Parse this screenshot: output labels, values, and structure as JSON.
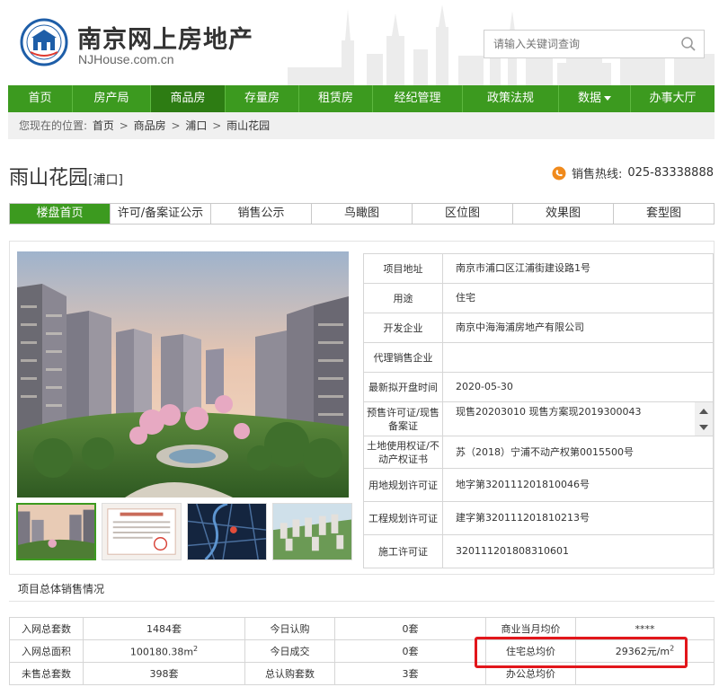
{
  "header": {
    "site_title": "南京网上房地产",
    "site_domain": "NJHouse.com.cn",
    "search_placeholder": "请输入关键词查询"
  },
  "nav": {
    "items": [
      {
        "label": "首页"
      },
      {
        "label": "房产局"
      },
      {
        "label": "商品房"
      },
      {
        "label": "存量房"
      },
      {
        "label": "租赁房"
      },
      {
        "label": "经纪管理"
      },
      {
        "label": "政策法规"
      },
      {
        "label": "数据"
      },
      {
        "label": "办事大厅"
      }
    ],
    "active_index": 2
  },
  "breadcrumb": {
    "prefix": "您现在的位置:",
    "items": [
      "首页",
      "商品房",
      "浦口",
      "雨山花园"
    ],
    "separator": ">"
  },
  "project": {
    "name": "雨山花园",
    "district": "[浦口]",
    "hotline_label": "销售热线:",
    "hotline_number": "025-83338888"
  },
  "tabs": [
    {
      "label": "楼盘首页",
      "active": true
    },
    {
      "label": "许可/备案证公示"
    },
    {
      "label": "销售公示"
    },
    {
      "label": "鸟瞰图"
    },
    {
      "label": "区位图"
    },
    {
      "label": "效果图"
    },
    {
      "label": "套型图"
    }
  ],
  "info": {
    "rows": [
      {
        "label": "项目地址",
        "value": "南京市浦口区江浦街建设路1号"
      },
      {
        "label": "用途",
        "value": "住宅"
      },
      {
        "label": "开发企业",
        "value": "南京中海海浦房地产有限公司"
      },
      {
        "label": "代理销售企业",
        "value": ""
      },
      {
        "label": "最新拟开盘时间",
        "value": "2020-05-30"
      },
      {
        "label": "预售许可证/现售备案证",
        "value": "现售20203010    现售方案现2019300043"
      },
      {
        "label": "土地使用权证/不动产权证书",
        "value": "苏（2018）宁浦不动产权第0015500号"
      },
      {
        "label": "用地规划许可证",
        "value": "地字第320111201810046号"
      },
      {
        "label": "工程规划许可证",
        "value": "建字第320111201810213号"
      },
      {
        "label": "施工许可证",
        "value": "320111201808310601"
      }
    ]
  },
  "summary": {
    "title": "项目总体销售情况",
    "rows": [
      [
        {
          "label": "入网总套数",
          "value": "1484套"
        },
        {
          "label": "今日认购",
          "value": "0套"
        },
        {
          "label": "商业当月均价",
          "value": "****"
        }
      ],
      [
        {
          "label": "入网总面积",
          "value": "100180.38m",
          "sup": "2"
        },
        {
          "label": "今日成交",
          "value": "0套"
        },
        {
          "label": "住宅总均价",
          "value": "29362元/m",
          "sup": "2"
        }
      ],
      [
        {
          "label": "未售总套数",
          "value": "398套"
        },
        {
          "label": "总认购套数",
          "value": "3套"
        },
        {
          "label": "办公总均价",
          "value": ""
        }
      ]
    ]
  },
  "colors": {
    "brand_green": "#3c9a1f",
    "highlight_red": "#e2161b"
  }
}
